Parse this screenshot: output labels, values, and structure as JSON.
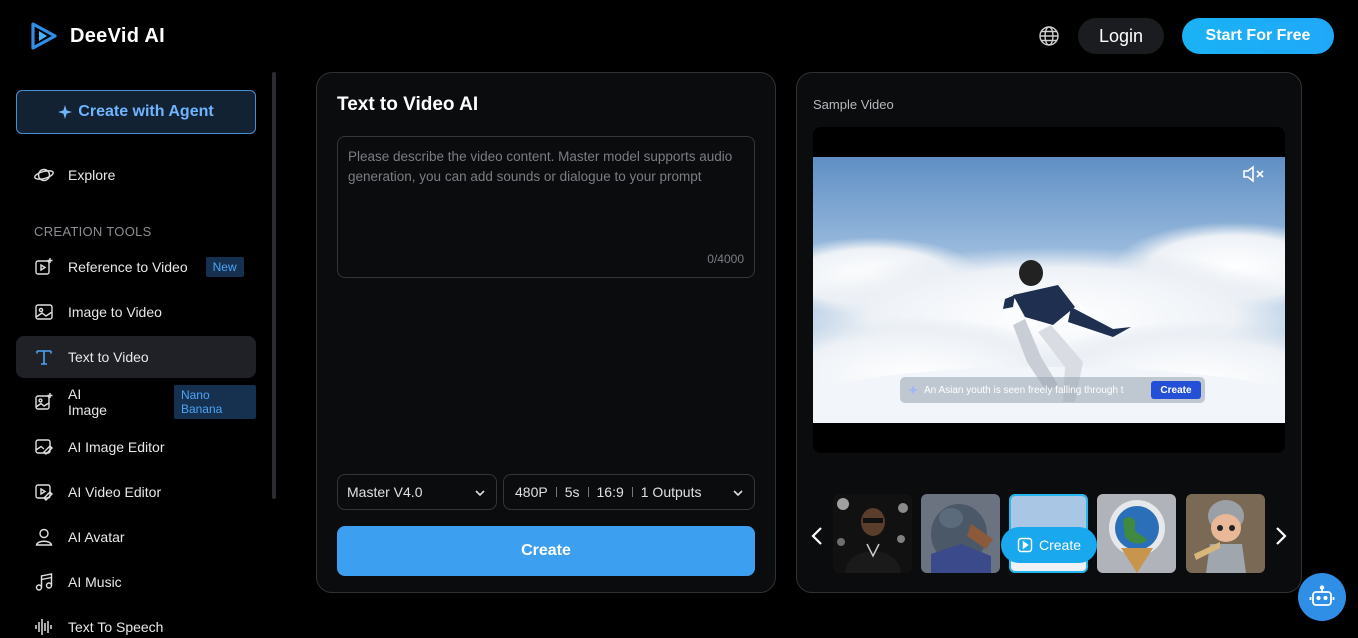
{
  "header": {
    "brand": "DeeVid AI",
    "login_label": "Login",
    "start_label": "Start For Free"
  },
  "sidebar": {
    "agent_label": "Create with Agent",
    "explore_label": "Explore",
    "section_title": "CREATION TOOLS",
    "items": [
      {
        "label": "Reference to Video",
        "badge": "New",
        "icon": "reference-video-icon"
      },
      {
        "label": "Image to Video",
        "icon": "image-icon"
      },
      {
        "label": "Text to Video",
        "icon": "text-icon",
        "active": true
      },
      {
        "label": "AI Image",
        "badge": "Nano Banana",
        "icon": "ai-image-icon"
      },
      {
        "label": "AI Image Editor",
        "icon": "image-editor-icon"
      },
      {
        "label": "AI Video Editor",
        "icon": "video-editor-icon"
      },
      {
        "label": "AI Avatar",
        "icon": "avatar-icon"
      },
      {
        "label": "AI Music",
        "icon": "music-icon"
      },
      {
        "label": "Text To Speech",
        "icon": "waveform-icon"
      }
    ]
  },
  "main": {
    "title": "Text to Video AI",
    "prompt_placeholder": "Please describe the video content. Master model supports audio generation, you can add sounds or dialogue to your prompt",
    "counter": "0/4000",
    "model": "Master V4.0",
    "resolution": "480P",
    "duration": "5s",
    "ratio": "16:9",
    "outputs": "1 Outputs",
    "create_label": "Create"
  },
  "sample": {
    "title": "Sample Video",
    "caption": "An Asian youth is seen freely falling through t",
    "caption_button": "Create",
    "thumb_create_label": "Create"
  },
  "colors": {
    "accent": "#3d9ff0",
    "cta": "#19b3f5",
    "agent_border": "#4a8fd6",
    "badge_text": "#4ea3f5"
  }
}
